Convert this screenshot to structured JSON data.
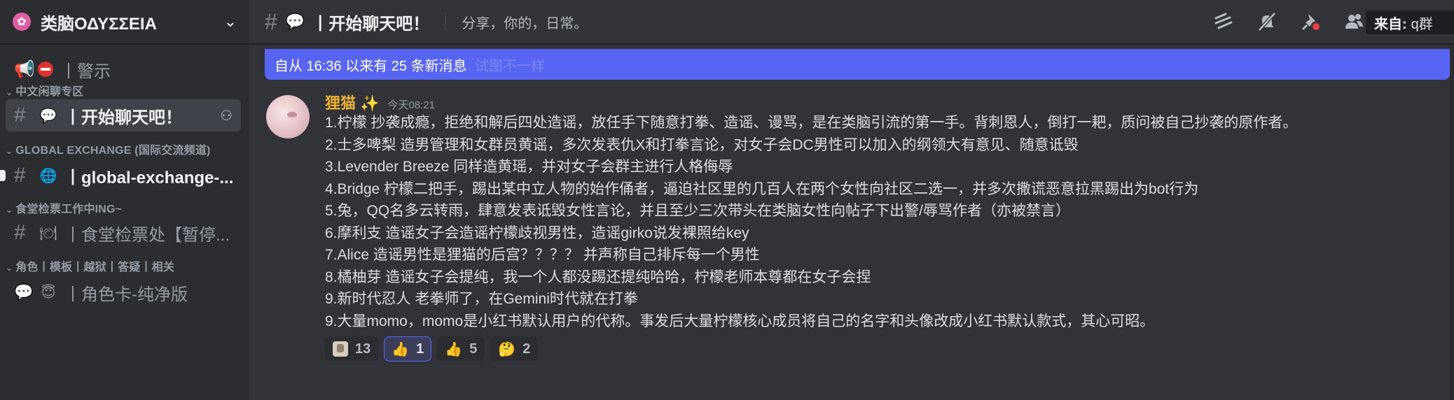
{
  "server": {
    "name": "类脑ΟΔΥΣΣΕΙΑ",
    "icon": "brain-flower-icon"
  },
  "sidebar": {
    "channels": [
      {
        "emoji": "⛔",
        "name": "丨警示"
      },
      {
        "emoji": "💬",
        "name": "丨开始聊天吧！",
        "active": true
      },
      {
        "emoji": "🌐",
        "name": "丨global-exchange-...",
        "unread": true
      },
      {
        "emoji": "🍽",
        "name": "丨食堂检票处【暂停..."
      },
      {
        "emoji": "😇",
        "name": "丨角色卡-纯净版"
      }
    ],
    "categories": [
      "中文闲聊专区",
      "GLOBAL EXCHANGE (国际交流频道)",
      "食堂检票工作中ING~",
      "角色丨模板丨越狱丨答疑丨相关"
    ]
  },
  "topbar": {
    "channel_emoji": "💬",
    "channel_name": "丨开始聊天吧！",
    "topic": "分享，你的，日常。",
    "search_label": "来自:",
    "search_value": "q群"
  },
  "banner": {
    "text": "自从 16:36 以来有 25 条新消息",
    "ghost_text": "试图不一样"
  },
  "message": {
    "author": "狸猫",
    "badge": "✨",
    "timestamp": "今天08:21",
    "lines": [
      "1.柠檬 抄袭成瘾，拒绝和解后四处造谣，放任手下随意打拳、造谣、谩骂，是在类脑引流的第一手。背刺恩人，倒打一耙，质问被自己抄袭的原作者。",
      "2.士多啤梨 造男管理和女群员黄谣，多次发表仇X和打拳言论，对女子会DC男性可以加入的纲领大有意见、随意诋毁",
      "3.Levender Breeze 同样造黄瑶，并对女子会群主进行人格侮辱",
      "4.Bridge 柠檬二把手，踢出某中立人物的始作俑者，逼迫社区里的几百人在两个女性向社区二选一，并多次撒谎恶意拉黑踢出为bot行为",
      "5.兔，QQ名多云转雨，肆意发表诋毁女性言论，并且至少三次带头在类脑女性向帖子下出警/辱骂作者（亦被禁言）",
      "6.摩利支 造谣女子会造谣柠檬歧视男性，造谣girko说发裸照给key",
      "7.Alice 造谣男性是狸猫的后宫？？？？ 并声称自己排斥每一个男性",
      "8.橘柚芽 造谣女子会提纯，我一个人都没踢还提纯哈哈，柠檬老师本尊都在女子会捏",
      "9.新时代忍人 老拳师了，在Gemini时代就在打拳",
      "9.大量momo，momo是小红书默认用户的代称。事发后大量柠檬核心成员将自己的名字和头像改成小红书默认款式，其心可昭。"
    ],
    "reactions": [
      {
        "emoji": "sticker",
        "count": "13",
        "me": false
      },
      {
        "emoji": "👍",
        "count": "1",
        "me": true
      },
      {
        "emoji": "👍",
        "count": "5",
        "me": false
      },
      {
        "emoji": "🤔",
        "count": "2",
        "me": false
      }
    ]
  }
}
